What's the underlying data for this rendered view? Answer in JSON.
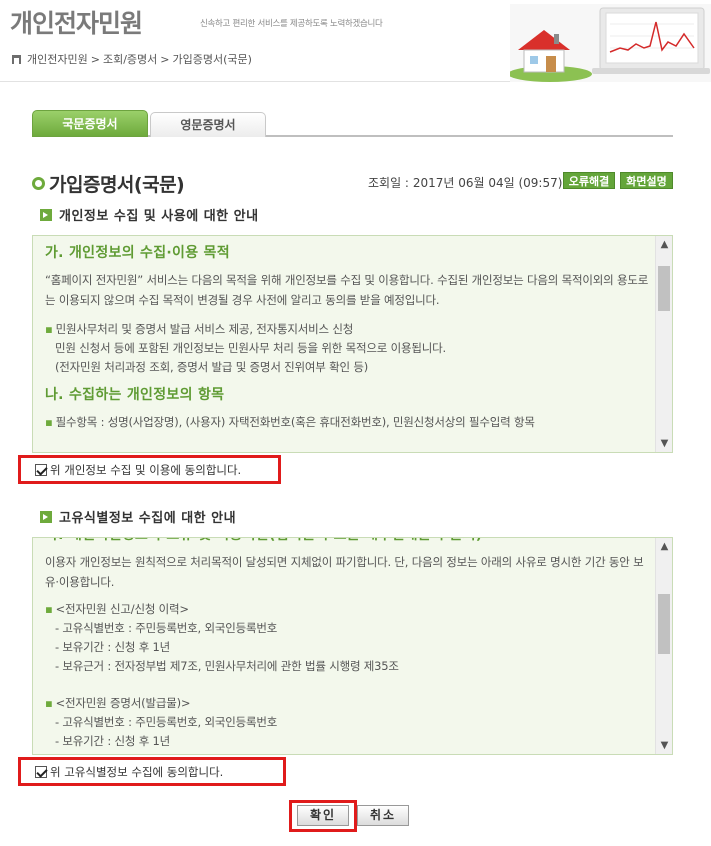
{
  "header": {
    "site_title": "개인전자민원",
    "slogan": "신속하고 편리한 서비스를 제공하도록 노력하겠습니다",
    "breadcrumb": [
      "개인전자민원",
      "조회/증명서",
      "가입증명서(국문)"
    ],
    "breadcrumb_separator": ">"
  },
  "tabs": [
    {
      "label": "국문증명서",
      "active": true
    },
    {
      "label": "영문증명서",
      "active": false
    }
  ],
  "page": {
    "title": "가입증명서(국문)",
    "view_date_label": "조회일 :",
    "view_date_value": "2017년 06월 04일 (09:57)",
    "error_button": "오류해결",
    "screen_button": "화면설명"
  },
  "section1": {
    "heading": "개인정보 수집 및 사용에 대한 안내",
    "sub1_title": "가. 개인정보의 수집·이용 목적",
    "sub1_para": "“홈페이지 전자민원” 서비스는 다음의 목적을 위해 개인정보를 수집 및 이용합니다. 수집된 개인정보는 다음의 목적이외의 용도로는 이용되지 않으며 수집 목적이 변경될 경우 사전에 알리고 동의를 받을 예정입니다.",
    "bullet1": "민원사무처리 및 증명서 발급 서비스 제공, 전자통지서비스 신청",
    "bullet1_line2": "민원 신청서 등에 포함된 개인정보는 민원사무 처리 등을 위한 목적으로 이용됩니다.",
    "bullet1_line3": "(전자민원 처리과정 조회, 증명서 발급 및 증명서 진위여부 확인 등)",
    "sub2_title": "나. 수집하는 개인정보의 항목",
    "sub2_bullet": "필수항목 : 성명(사업장명), (사용자) 자택전화번호(혹은 휴대전화번호), 민원신청서상의 필수입력 항목",
    "agree_label": "위 개인정보 수집 및 이용에 동의합니다.",
    "agree_checked": true
  },
  "section2": {
    "heading": "고유식별정보 수집에 대한 안내",
    "cut_title": "가. 개인식별정보의 보유 및 이용기간(법적근거 또는 내부결재문서 근거)",
    "para": "이용자 개인정보는 원칙적으로 처리목적이 달성되면 지체없이 파기합니다. 단, 다음의 정보는 아래의 사유로 명시한 기간 동안 보유·이용합니다.",
    "group1_title": "<전자민원 신고/신청 이력>",
    "group1_items": [
      "- 고유식별번호 : 주민등록번호, 외국인등록번호",
      "- 보유기간 : 신청 후 1년",
      "- 보유근거 : 전자정부법 제7조, 민원사무처리에 관한 법률 시행령 제35조"
    ],
    "group2_title": "<전자민원 증명서(발급물)>",
    "group2_items": [
      "- 고유식별번호 : 주민등록번호, 외국인등록번호",
      "- 보유기간 : 신청 후 1년"
    ],
    "agree_label": "위 고유식별정보 수집에 동의합니다.",
    "agree_checked": true
  },
  "buttons": {
    "confirm": "확인",
    "cancel": "취소"
  },
  "scroll_arrows": {
    "up": "▲",
    "down": "▼"
  },
  "colors": {
    "accent_green": "#6eaa3c",
    "highlight_red": "#e01b1b",
    "box_bg": "#f3f8ec"
  }
}
